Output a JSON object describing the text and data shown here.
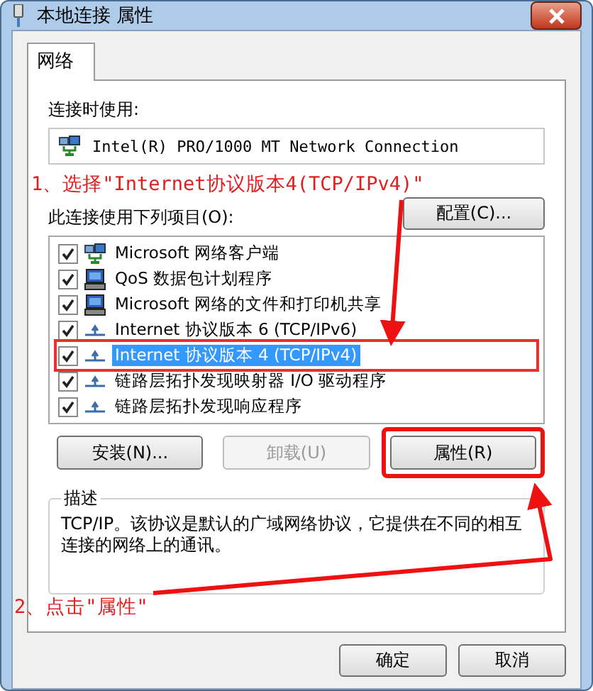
{
  "window": {
    "title": "本地连接 属性"
  },
  "tabs": [
    {
      "label": "网络",
      "selected": true
    }
  ],
  "connect_using": {
    "label": "连接时使用:",
    "adapter": "Intel(R) PRO/1000 MT Network Connection",
    "configure_button": "配置(C)..."
  },
  "annotations": [
    {
      "text": "1、选择\"Internet协议版本4(TCP/IPv4)\""
    },
    {
      "text": "2、点击\"属性\""
    }
  ],
  "items_label": "此连接使用下列项目(O):",
  "items": [
    {
      "kind": "client",
      "label": "Microsoft 网络客户端",
      "checked": true,
      "selected": false,
      "highlighted": false
    },
    {
      "kind": "service",
      "label": "QoS 数据包计划程序",
      "checked": true,
      "selected": false,
      "highlighted": false
    },
    {
      "kind": "service",
      "label": "Microsoft 网络的文件和打印机共享",
      "checked": true,
      "selected": false,
      "highlighted": false
    },
    {
      "kind": "protocol",
      "label": "Internet 协议版本 6 (TCP/IPv6)",
      "checked": true,
      "selected": false,
      "highlighted": false
    },
    {
      "kind": "protocol",
      "label": "Internet 协议版本 4 (TCP/IPv4)",
      "checked": true,
      "selected": true,
      "highlighted": true
    },
    {
      "kind": "protocol",
      "label": "链路层拓扑发现映射器 I/O 驱动程序",
      "checked": true,
      "selected": false,
      "highlighted": false
    },
    {
      "kind": "protocol",
      "label": "链路层拓扑发现响应程序",
      "checked": true,
      "selected": false,
      "highlighted": false
    }
  ],
  "item_buttons": [
    {
      "label": "安装(N)...",
      "disabled": false,
      "highlighted": false
    },
    {
      "label": "卸载(U)",
      "disabled": true,
      "highlighted": false
    },
    {
      "label": "属性(R)",
      "disabled": false,
      "highlighted": true
    }
  ],
  "description": {
    "title": "描述",
    "text": "TCP/IP。该协议是默认的广域网络协议，它提供在不同的相互连接的网络上的通讯。"
  },
  "dialog_buttons": [
    "确定",
    "取消"
  ]
}
